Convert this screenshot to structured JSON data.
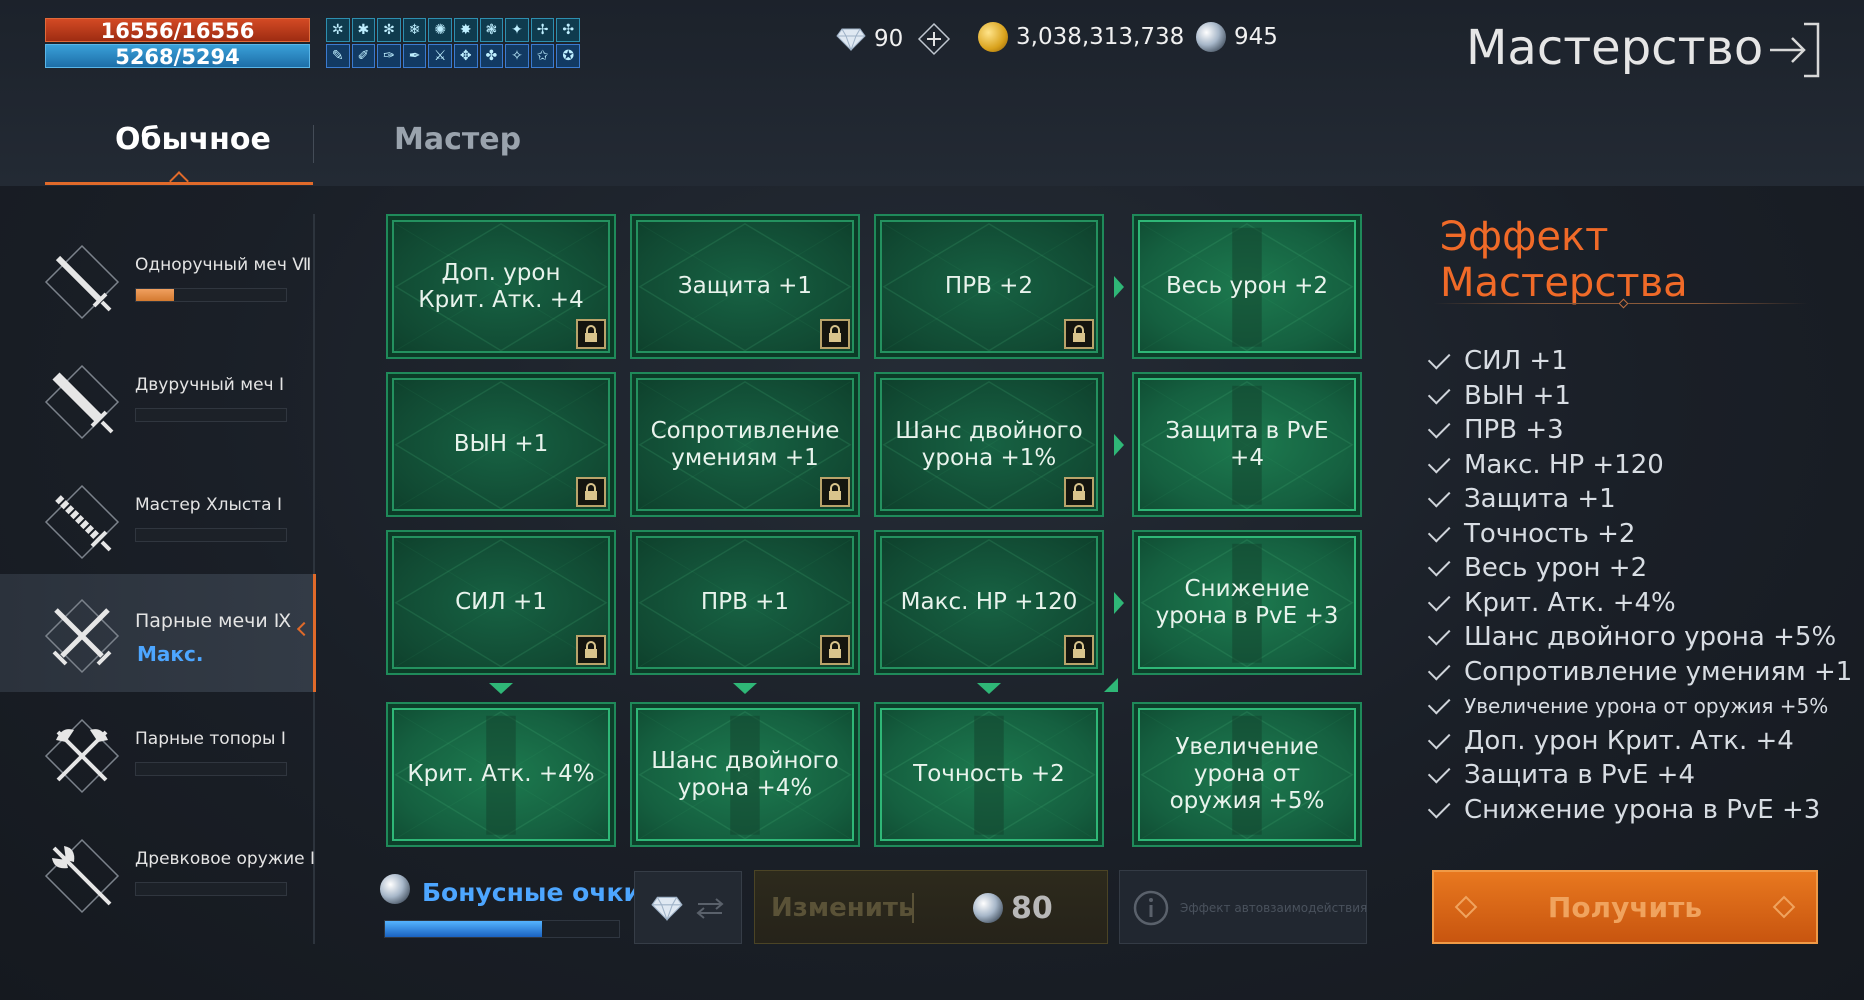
{
  "stats": {
    "hp": "16556/16556",
    "mp": "5268/5294"
  },
  "currency": {
    "diamonds": "90",
    "gold": "3,038,313,738",
    "silver": "945"
  },
  "header": {
    "title": "Мастерство"
  },
  "tabs": [
    {
      "label": "Обычное"
    },
    {
      "label": "Мастер"
    }
  ],
  "weapons": [
    {
      "name": "Одноручный меч Ⅶ",
      "progress": 0.25
    },
    {
      "name": "Двуручный меч Ⅰ",
      "progress": 0
    },
    {
      "name": "Мастер Хлыста Ⅰ",
      "progress": 0
    },
    {
      "name": "Парные мечи Ⅸ",
      "status": "Макс."
    },
    {
      "name": "Парные топоры Ⅰ",
      "progress": 0
    },
    {
      "name": "Древковое оружие Ⅰ",
      "progress": 0
    }
  ],
  "grid": {
    "rows": [
      [
        "Доп. урон Крит. Атк. +4",
        "Защита +1",
        "ПРВ +2",
        "Весь урон +2"
      ],
      [
        "ВЫН +1",
        "Сопротивление умениям +1",
        "Шанс двойного урона +1%",
        "Защита в PvE +4"
      ],
      [
        "СИЛ +1",
        "ПРВ +1",
        "Макс. HP +120",
        "Снижение урона в PvE +3"
      ],
      [
        "Крит. Атк. +4%",
        "Шанс двойного урона +4%",
        "Точность +2",
        "Увеличение урона от оружия +5%"
      ]
    ]
  },
  "bonus": {
    "label": "Бонусные очки",
    "progress": 0.67
  },
  "actions": {
    "change_label": "Изменить",
    "change_cost": "80",
    "auto_label": "Эффект автовзаимодействия"
  },
  "effect": {
    "title": "Эффект Мастерства",
    "items": [
      "СИЛ +1",
      "ВЫН +1",
      "ПРВ +3",
      "Макс. HP +120",
      "Защита +1",
      "Точность +2",
      "Весь урон +2",
      "Крит. Атк. +4%",
      "Шанс двойного урона +5%",
      "Сопротивление умениям +1",
      "Увеличение урона от оружия  +5%",
      "Доп. урон Крит. Атк. +4",
      "Защита в PvE +4",
      "Снижение урона в PvE +3"
    ],
    "claim_label": "Получить"
  },
  "colors": {
    "accent": "#e06a2a",
    "node_green": "#1f8a5a",
    "blue": "#4da6ff"
  }
}
